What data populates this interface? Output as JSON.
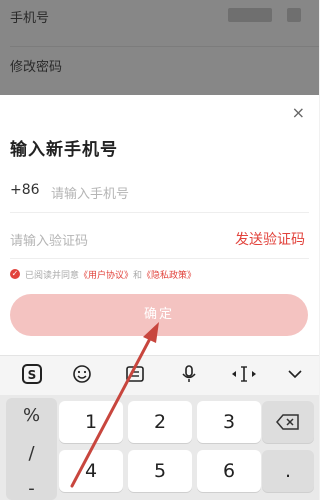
{
  "background_page": {
    "rows": [
      {
        "label": "手机号"
      },
      {
        "label": "修改密码"
      }
    ]
  },
  "sheet": {
    "close_label": "×",
    "title": "输入新手机号",
    "country_code": "+86",
    "phone_placeholder": "请输入手机号",
    "code_placeholder": "请输入验证码",
    "send_code_label": "发送验证码",
    "agreement": {
      "check_mark": "✓",
      "prefix": "已阅读并同意",
      "user_agreement": "《用户协议》",
      "and": "和",
      "privacy_policy": "《隐私政策》"
    },
    "confirm_label": "确定"
  },
  "keyboard": {
    "toolbar_icons": [
      {
        "name": "sogou-logo-icon",
        "glyph": "S"
      },
      {
        "name": "emoji-icon",
        "glyph": "☺"
      },
      {
        "name": "clipboard-icon",
        "glyph": "▤"
      },
      {
        "name": "microphone-icon",
        "glyph": "🎙"
      },
      {
        "name": "cursor-move-icon",
        "glyph": "◂I▸"
      },
      {
        "name": "collapse-keyboard-icon",
        "glyph": "∨"
      }
    ],
    "side_keys": [
      "%",
      "/",
      "-"
    ],
    "keys_row1": [
      "1",
      "2",
      "3"
    ],
    "keys_row2": [
      "4",
      "5",
      "6"
    ],
    "backspace_icon": "backspace-icon",
    "dot_key": "."
  },
  "colors": {
    "accent": "#e2433c",
    "confirm_disabled": "#f4c3c1",
    "annotation_arrow": "#c8463e"
  }
}
